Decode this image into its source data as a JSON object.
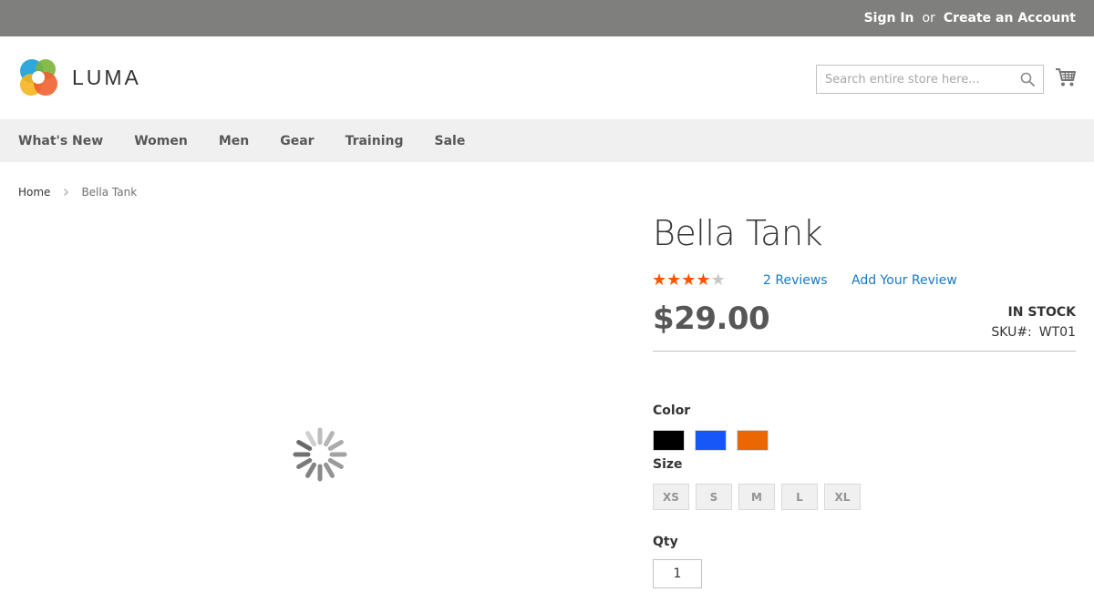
{
  "top_links": {
    "sign_in": "Sign In",
    "or": "or",
    "create_account": "Create an Account"
  },
  "logo": {
    "text": "LUMA"
  },
  "search": {
    "placeholder": "Search entire store here...",
    "value": ""
  },
  "icons": {
    "search": "search-icon",
    "cart": "cart-icon",
    "loader": "loading-spinner-icon",
    "breadcrumb_separator": "chevron-right-icon"
  },
  "nav": {
    "items": [
      "What's New",
      "Women",
      "Men",
      "Gear",
      "Training",
      "Sale"
    ]
  },
  "breadcrumb": {
    "home": "Home",
    "current": "Bella Tank"
  },
  "product": {
    "title": "Bella Tank",
    "rating": {
      "stars_filled": 4,
      "stars_total": 5
    },
    "reviews_link": "2 Reviews",
    "add_review": "Add Your Review",
    "price": "$29.00",
    "stock": "IN STOCK",
    "sku_label": "SKU#:",
    "sku_value": "WT01",
    "color_label": "Color",
    "colors": [
      {
        "name": "Black",
        "hex": "#000000"
      },
      {
        "name": "Blue",
        "hex": "#1857f7"
      },
      {
        "name": "Orange",
        "hex": "#eb6703"
      }
    ],
    "size_label": "Size",
    "sizes": [
      "XS",
      "S",
      "M",
      "L",
      "XL"
    ],
    "qty_label": "Qty",
    "qty_value": "1"
  },
  "colors": {
    "link": "#1979c3",
    "star_filled": "#ff5501",
    "star_empty": "#c7c7c7",
    "top_bar": "#7f7f7d",
    "nav_bg": "#f0f0f0"
  }
}
